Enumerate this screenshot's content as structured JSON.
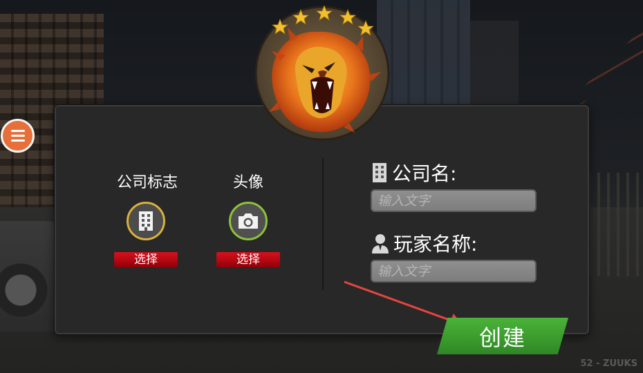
{
  "badge": {
    "icon": "lion-emblem",
    "star_count": 5,
    "star_color": "#f2c02c"
  },
  "menu": {
    "icon": "hamburger-menu-icon",
    "color": "#e76f3a"
  },
  "upload": {
    "logo": {
      "label": "公司标志",
      "icon": "building-icon",
      "button": "选择",
      "ring_color": "#d9b23c"
    },
    "avatar": {
      "label": "头像",
      "icon": "camera-icon",
      "button": "选择",
      "ring_color": "#8ec23c"
    }
  },
  "form": {
    "company": {
      "label": "公司名:",
      "icon": "building-icon",
      "placeholder": "输入文字",
      "value": ""
    },
    "player": {
      "label": "玩家名称:",
      "icon": "person-icon",
      "placeholder": "输入文字",
      "value": ""
    }
  },
  "create_button": {
    "label": "创建",
    "color": "#3ea532"
  },
  "watermark": "52 - ZUUKS",
  "colors": {
    "panel": "#282828",
    "select_button": "#c30c17"
  }
}
